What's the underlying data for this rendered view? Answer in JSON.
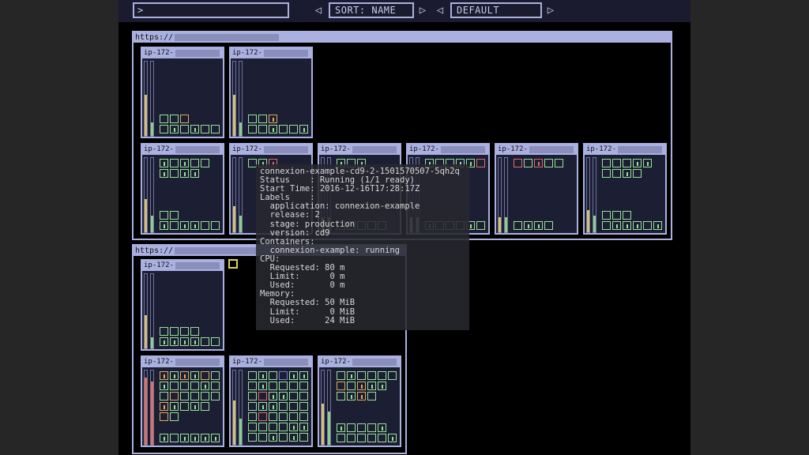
{
  "toolbar": {
    "filter_value": ">",
    "sort_label": "SORT: NAME",
    "theme_label": "DEFAULT",
    "prev_symbol": "◁",
    "next_symbol": "▷"
  },
  "clusters": [
    {
      "url_prefix": "https://"
    },
    {
      "url_prefix": "https://"
    }
  ],
  "node_name_prefix": "ip-172-",
  "tooltip_lines": [
    "connexion-example-cd9-2-1501570507-5qh2q",
    "Status    : Running (1/1 ready)",
    "Start Time: 2016-12-16T17:28:17Z",
    "Labels    :",
    "  application: connexion-example",
    "  release: 2",
    "  stage: production",
    "  version: cd9",
    "Containers:",
    "  connexion-example: running",
    "CPU:",
    "  Requested: 80 m",
    "  Limit:      0 m",
    "  Used:       0 m",
    "Memory:",
    "  Requested: 50 MiB",
    "  Limit:      0 MiB",
    "  Used:      24 MiB"
  ],
  "colors": {
    "frame": "#aab0e0",
    "node_bg": "#1c1e33",
    "pod_ok": "#98e098",
    "pod_warn": "#e0a860",
    "pod_error": "#e06a6a",
    "pod_pending": "#e0d060",
    "cpu_fill": "#d8c070",
    "mem_fill": "#8ad08a",
    "cpu_fill_high": "#e07060"
  }
}
